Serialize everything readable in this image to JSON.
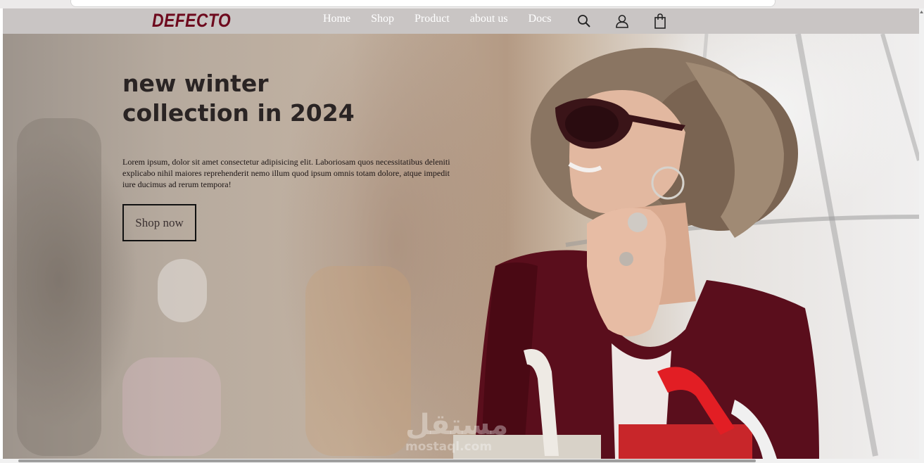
{
  "brand": {
    "name": "DEFECTO",
    "color": "#6e0a1e"
  },
  "nav": {
    "items": [
      {
        "label": "Home"
      },
      {
        "label": "Shop"
      },
      {
        "label": "Product"
      },
      {
        "label": "about us"
      },
      {
        "label": "Docs"
      }
    ],
    "icons": [
      "search-icon",
      "user-icon",
      "shopping-bag-icon"
    ]
  },
  "hero": {
    "headline_line1": "new winter",
    "headline_line2": "collection in 2024",
    "description": "Lorem ipsum, dolor sit amet consectetur adipisicing elit. Laboriosam quos necessitatibus deleniti explicabo nihil maiores reprehenderit nemo illum quod ipsum omnis totam dolore, atque impedit iure ducimus ad rerum tempora!",
    "cta_label": "Shop now"
  },
  "watermark": {
    "arabic": "مستقل",
    "latin": "mostaql.com"
  },
  "colors": {
    "navbar_bg": "#c9c5c4",
    "text_dark": "#2a2424",
    "dress": "#5a0e1c"
  }
}
